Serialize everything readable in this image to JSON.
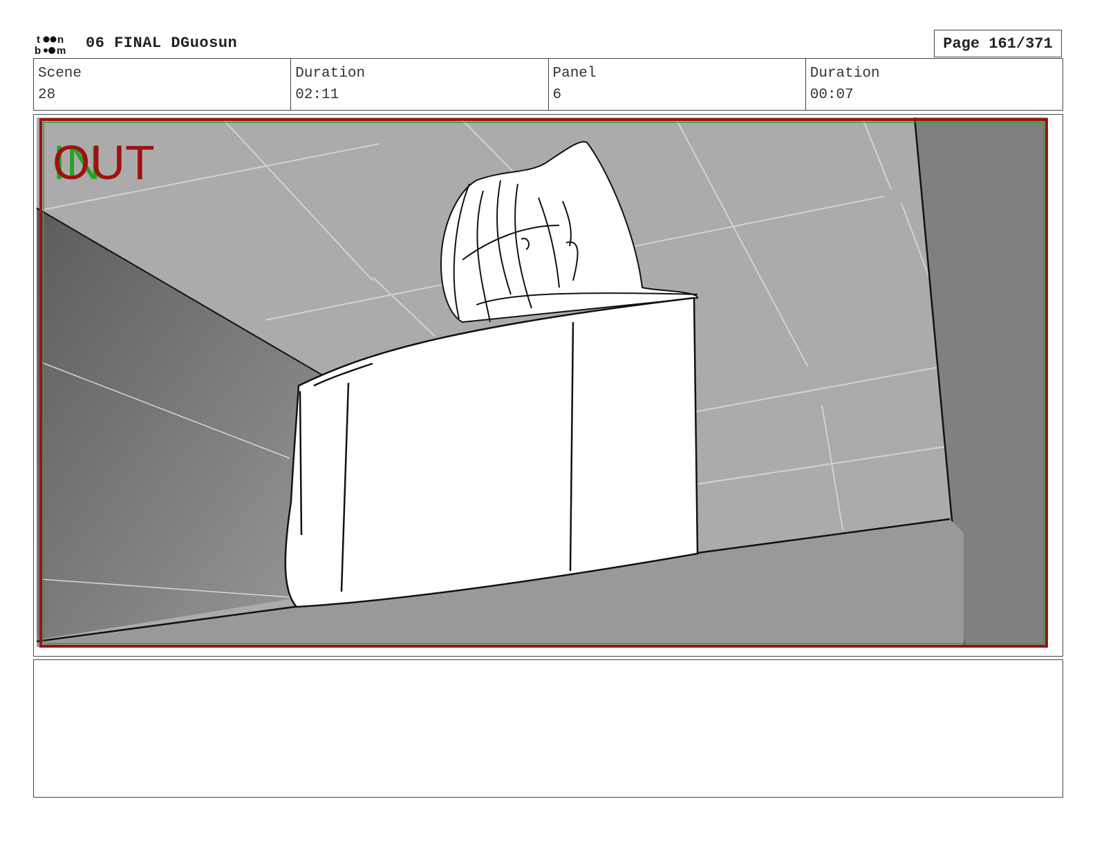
{
  "header": {
    "logo_text": "toon boom",
    "title": "06 FINAL DGuosun",
    "page_label": "Page 161/371"
  },
  "info": {
    "scene_label": "Scene",
    "scene_value": "28",
    "scene_duration_label": "Duration",
    "scene_duration_value": "02:11",
    "panel_label": "Panel",
    "panel_value": "6",
    "panel_duration_label": "Duration",
    "panel_duration_value": "00:07"
  },
  "panel": {
    "in_marker": "IN",
    "out_marker": "OUT",
    "in_color": "#22a722",
    "out_color": "#a01010",
    "frame_color": "#a01010"
  },
  "notes": {
    "text": ""
  }
}
